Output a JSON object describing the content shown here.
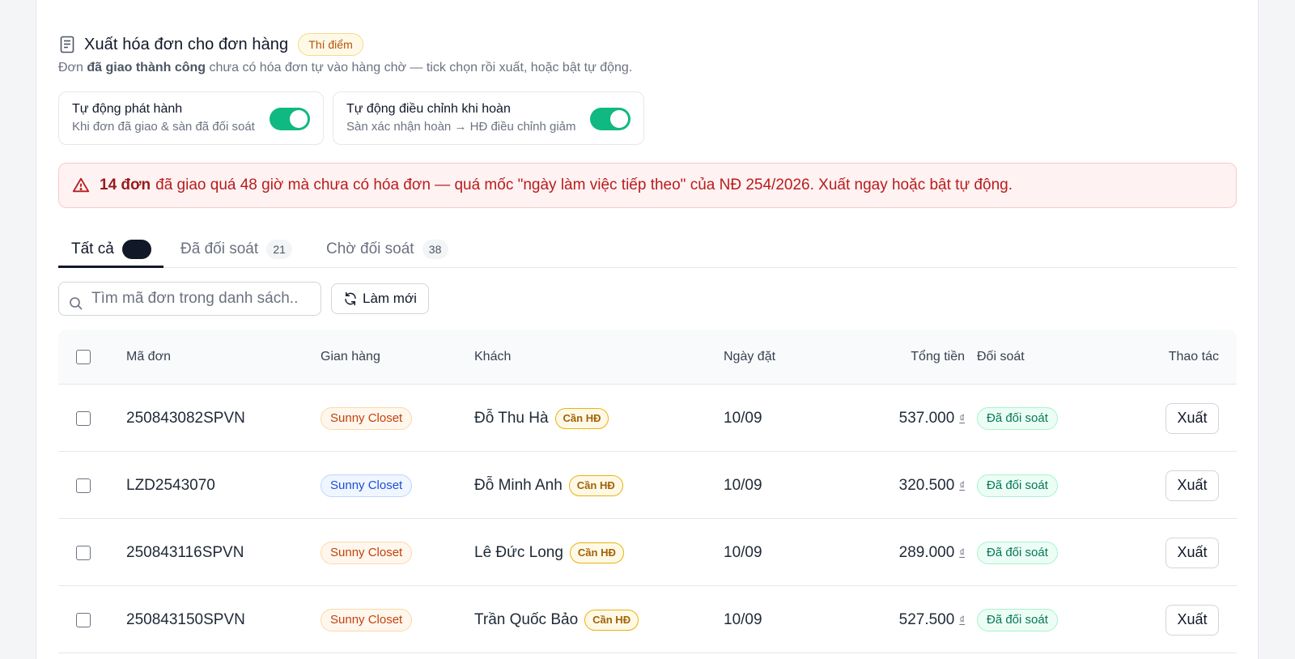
{
  "header": {
    "title": "Xuất hóa đơn cho đơn hàng",
    "badge": "Thí điểm",
    "subtitle_prefix": "Đơn ",
    "subtitle_bold": "đã giao thành công",
    "subtitle_suffix": " chưa có hóa đơn tự vào hàng chờ — tick chọn rồi xuất, hoặc bật tự động."
  },
  "toggles": [
    {
      "title": "Tự động phát hành",
      "subtitle": "Khi đơn đã giao & sàn đã đối soát",
      "on": true
    },
    {
      "title": "Tự động điều chỉnh khi hoàn",
      "subtitle": "Sàn xác nhận hoàn → HĐ điều chỉnh giảm",
      "on": true
    }
  ],
  "alert": {
    "bold": "14 đơn",
    "text": "đã giao quá 48 giờ mà chưa có hóa đơn — quá mốc \"ngày làm việc tiếp theo\" của NĐ 254/2026. Xuất ngay hoặc bật tự động."
  },
  "tabs": [
    {
      "label": "Tất cả",
      "count": "",
      "active": true
    },
    {
      "label": "Đã đối soát",
      "count": "21",
      "active": false
    },
    {
      "label": "Chờ đối soát",
      "count": "38",
      "active": false
    }
  ],
  "search": {
    "placeholder": "Tìm mã đơn trong danh sách..",
    "value": ""
  },
  "refresh_label": "Làm mới",
  "table": {
    "columns": [
      "Mã đơn",
      "Gian hàng",
      "Khách",
      "Ngày đặt",
      "Tổng tiền",
      "Đối soát",
      "Thao tác"
    ],
    "currency_symbol": "₫",
    "rows": [
      {
        "order_id": "250843082SPVN",
        "shop": "Sunny Closet",
        "shop_color": "orange",
        "customer": "Đỗ Thu Hà",
        "need": "Cần HĐ",
        "date": "10/09",
        "total": "537.000",
        "recon": "Đã đối soát",
        "action": "Xuất"
      },
      {
        "order_id": "LZD2543070",
        "shop": "Sunny Closet",
        "shop_color": "blue",
        "customer": "Đỗ Minh Anh",
        "need": "Cần HĐ",
        "date": "10/09",
        "total": "320.500",
        "recon": "Đã đối soát",
        "action": "Xuất"
      },
      {
        "order_id": "250843116SPVN",
        "shop": "Sunny Closet",
        "shop_color": "orange",
        "customer": "Lê Đức Long",
        "need": "Cần HĐ",
        "date": "10/09",
        "total": "289.000",
        "recon": "Đã đối soát",
        "action": "Xuất"
      },
      {
        "order_id": "250843150SPVN",
        "shop": "Sunny Closet",
        "shop_color": "orange",
        "customer": "Trần Quốc Bảo",
        "need": "Cần HĐ",
        "date": "10/09",
        "total": "527.500",
        "recon": "Đã đối soát",
        "action": "Xuất"
      }
    ]
  },
  "colors": {
    "accent_green": "#10b981",
    "alert_red": "#b91c1c",
    "pilot_amber": "#b45309",
    "shop_orange": "#c2410c",
    "shop_blue": "#1d4ed8"
  }
}
